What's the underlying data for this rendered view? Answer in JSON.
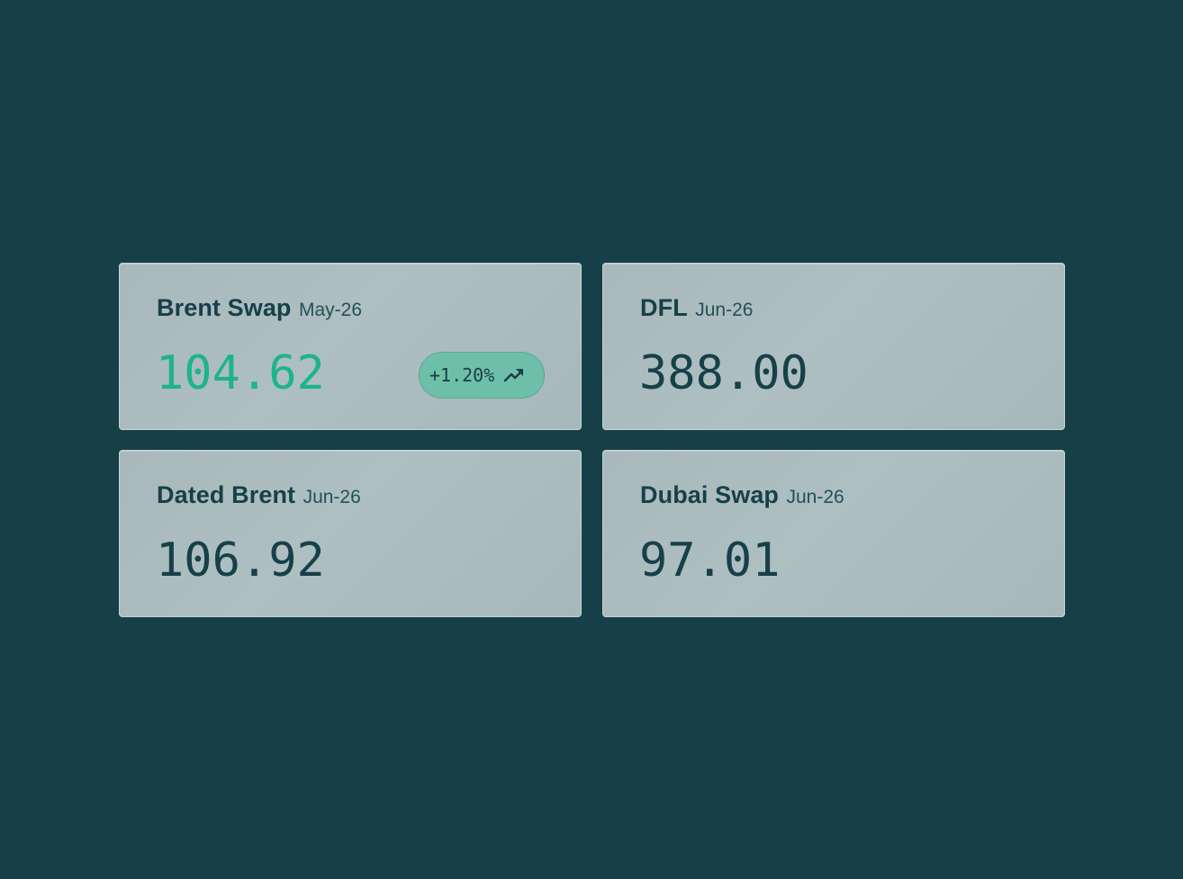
{
  "cards": [
    {
      "name": "Brent Swap",
      "period": "May-26",
      "price": "104.62",
      "change": "+1.20%",
      "change_icon": "trending-up-icon",
      "price_color": "#1db584"
    },
    {
      "name": "DFL",
      "period": "Jun-26",
      "price": "388.00"
    },
    {
      "name": "Dated Brent",
      "period": "Jun-26",
      "price": "106.92"
    },
    {
      "name": "Dubai Swap",
      "period": "Jun-26",
      "price": "97.01"
    }
  ],
  "colors": {
    "background": "#163f48",
    "card": "#aebfc1",
    "text": "#174049",
    "positive": "#1db584",
    "badge": "#6ebfa8"
  }
}
